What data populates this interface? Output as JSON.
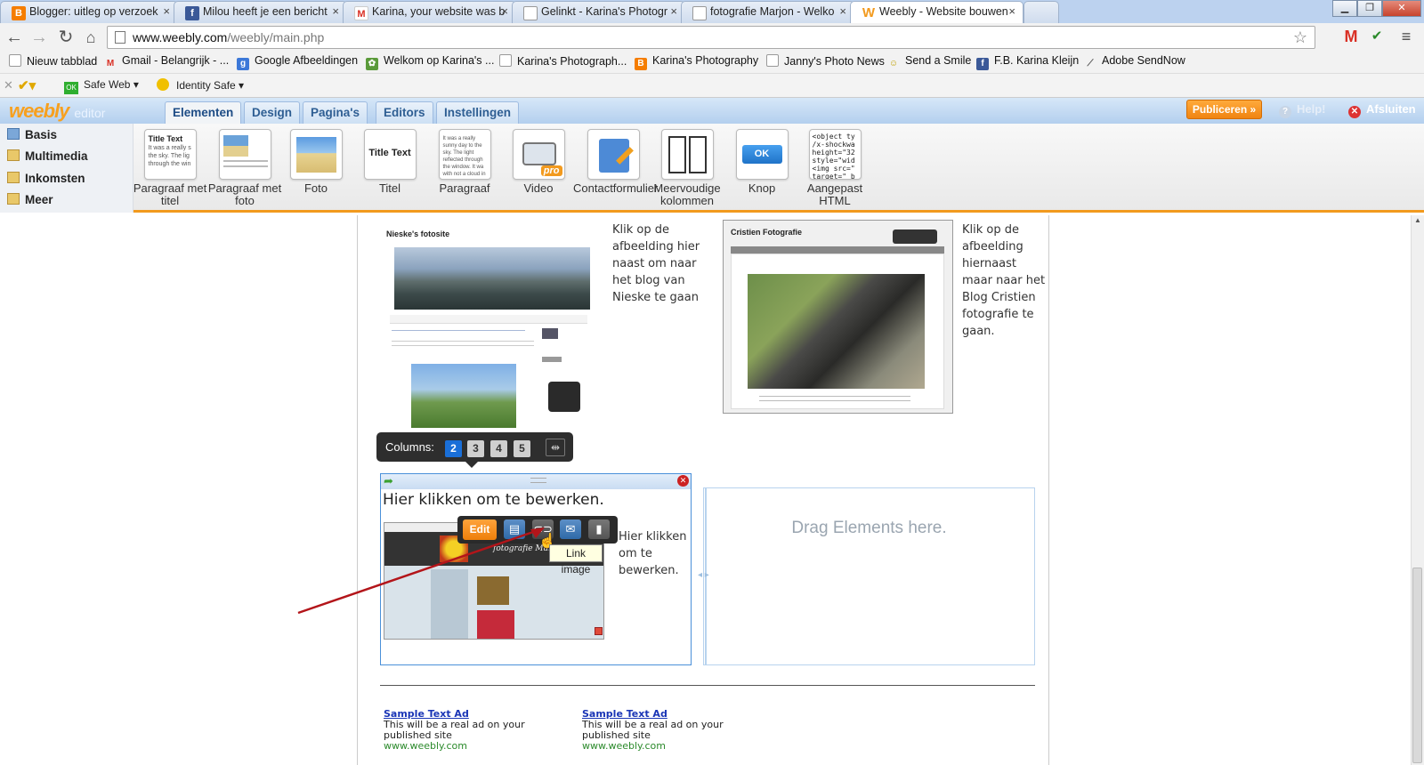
{
  "browser": {
    "tabs": [
      {
        "title": "Blogger: uitleg op verzoek",
        "icon": "blogger-icon",
        "color": "#f57d00",
        "glyph": "B"
      },
      {
        "title": "Milou heeft je een bericht",
        "icon": "facebook-icon",
        "color": "#3b5998",
        "glyph": "f"
      },
      {
        "title": "Karina, your website was b",
        "icon": "gmail-icon",
        "color": "#d93025",
        "glyph": "M"
      },
      {
        "title": "Gelinkt - Karina's Photogr",
        "icon": "page-icon",
        "color": "#9aa0a6",
        "glyph": ""
      },
      {
        "title": "fotografie Marjon - Welko",
        "icon": "page-icon",
        "color": "#9aa0a6",
        "glyph": ""
      },
      {
        "title": "Weebly - Website bouwen",
        "icon": "weebly-icon",
        "color": "#f29a1e",
        "glyph": "W"
      }
    ],
    "url_host": "www.weebly.com",
    "url_path": "/weebly/main.php",
    "bookmarks": [
      {
        "label": "Nieuw tabblad",
        "icon": "page-icon",
        "color": "#ffffff"
      },
      {
        "label": "Gmail - Belangrijk - ...",
        "icon": "gmail-icon",
        "color": "#d93025"
      },
      {
        "label": "Google Afbeeldingen",
        "icon": "google-icon",
        "color": "#3c78d8"
      },
      {
        "label": "Welkom op Karina's ...",
        "icon": "flower-icon",
        "color": "#5a9a3a"
      },
      {
        "label": "Karina's Photograph...",
        "icon": "page-icon",
        "color": "#ffffff"
      },
      {
        "label": "Karina's Photography",
        "icon": "blogger-icon",
        "color": "#f57d00"
      },
      {
        "label": "Janny's Photo News",
        "icon": "page-icon",
        "color": "#ffffff"
      },
      {
        "label": "Send a Smile",
        "icon": "smile-icon",
        "color": "#f0c020"
      },
      {
        "label": "F.B. Karina Kleijn",
        "icon": "facebook-icon",
        "color": "#3b5998"
      },
      {
        "label": "Adobe SendNow",
        "icon": "adobe-icon",
        "color": "#555555"
      }
    ],
    "ext": {
      "safe_web": "Safe Web",
      "identity_safe": "Identity Safe"
    }
  },
  "weebly": {
    "logo": "weebly",
    "logo_sub": "editor",
    "tabs": [
      "Elementen",
      "Design",
      "Pagina's",
      "Editors",
      "Instellingen"
    ],
    "publish": "Publiceren »",
    "help": "Help!",
    "close": "Afsluiten",
    "categories": [
      "Basis",
      "Multimedia",
      "Inkomsten",
      "Meer"
    ],
    "elements": [
      {
        "label": "Paragraaf met titel",
        "thumb": "Title Text"
      },
      {
        "label": "Paragraaf met foto",
        "thumb": ""
      },
      {
        "label": "Foto",
        "thumb": ""
      },
      {
        "label": "Titel",
        "thumb": "Title Text"
      },
      {
        "label": "Paragraaf",
        "thumb": ""
      },
      {
        "label": "Video",
        "thumb": "pro"
      },
      {
        "label": "Contactformulier",
        "thumb": ""
      },
      {
        "label": "Meervoudige kolommen",
        "thumb": ""
      },
      {
        "label": "Knop",
        "thumb": "OK"
      },
      {
        "label": "Aangepast HTML",
        "thumb": "<object ty /x-shockwa height=\"32 style=\"wid <img src=\" target=\"_b"
      }
    ],
    "thumb_para_text": "It was a really s the sky. The lig through the win",
    "thumb_para2_text": "It was a really sunny day to the sky. The light reflected through the window. It wa with not a cloud in the sky of the bay directly through reflected off of the bay dir"
  },
  "content": {
    "nieske_title": "Nieske's fotosite",
    "nieske_text": "Klik op de afbeelding hier naast om naar het blog van Nieske te gaan",
    "cristien_title": "Cristien Fotografie",
    "cristien_text": "Klik op de afbeelding hiernaast maar naar het Blog Cristien fotografie te gaan.",
    "columns_label": "Columns:",
    "columns": [
      "2",
      "3",
      "4",
      "5"
    ],
    "edit_heading": "Hier klikken om te bewerken.",
    "edit_side": "Hier klikken om te bewerken.",
    "edit_button": "Edit",
    "tooltip": "Link image",
    "marjon_title": "fotografie Marjon",
    "drag_text": "Drag Elements here.",
    "ads": [
      {
        "title": "Sample Text Ad",
        "body": "This will be a real ad on your published site",
        "url": "www.weebly.com"
      },
      {
        "title": "Sample Text Ad",
        "body": "This will be a real ad on your published site",
        "url": "www.weebly.com"
      }
    ]
  },
  "colors": {
    "accent_orange": "#f29a1e",
    "weebly_blue": "#2e5e93",
    "annotation_arrow": "#b3151a"
  }
}
